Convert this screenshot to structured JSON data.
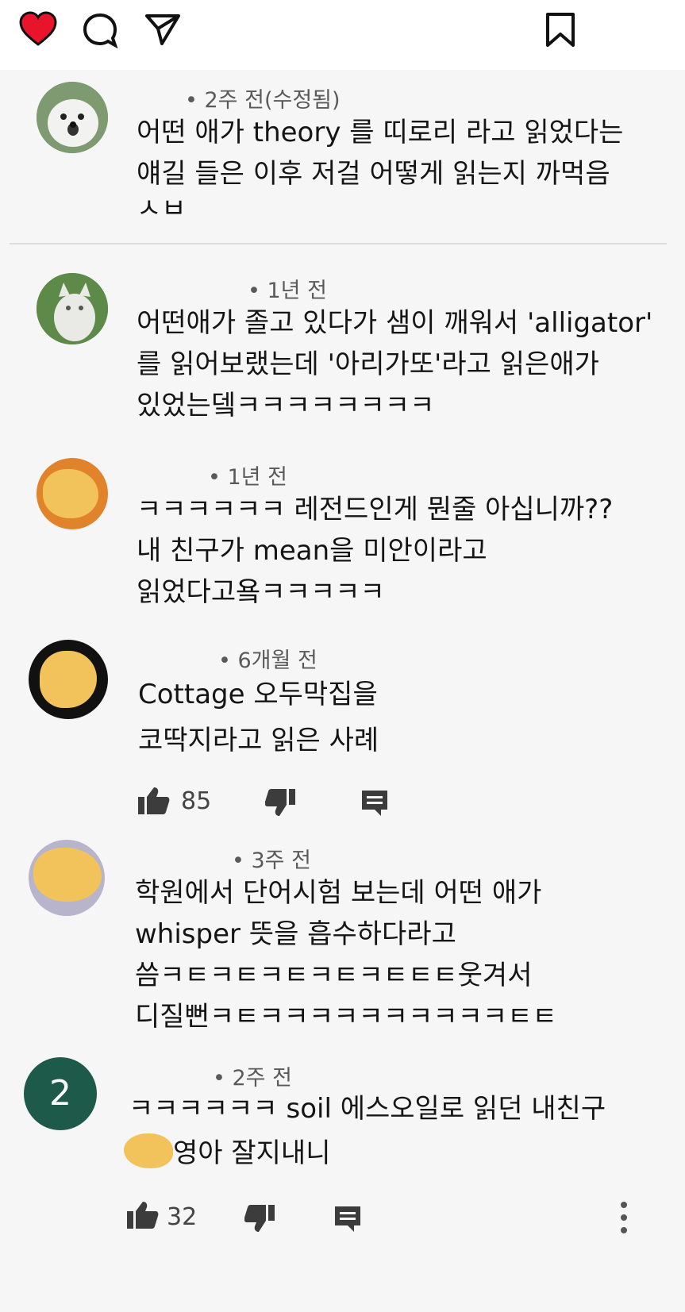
{
  "topbar": {
    "icons": [
      "heart-icon",
      "comment-icon",
      "share-icon",
      "bookmark-icon"
    ],
    "heart_color": "#e8142c"
  },
  "comments": [
    {
      "meta": "• 2주 전(수정됨)",
      "lines": [
        "어떤 애가 theory 를 띠로리 라고 읽었다는",
        "얘길 들은 이후 저걸 어떻게 읽는지 까먹음",
        "ㅅㅂ"
      ]
    },
    {
      "meta": "• 1년 전",
      "lines": [
        "어떤애가 졸고 있다가 샘이 깨워서 'alligator'",
        "를 읽어보랬는데 '아리가또'라고 읽은애가",
        "있었는뎈ㅋㅋㅋㅋㅋㅋㅋㅋ"
      ]
    },
    {
      "meta": "• 1년 전",
      "lines": [
        "ㅋㅋㅋㅋㅋㅋ 레전드인게 뭔줄 아십니까??",
        "내 친구가 mean을 미안이라고",
        "읽었다고욬ㅋㅋㅋㅋㅋ"
      ]
    },
    {
      "meta": "• 6개월 전",
      "lines": [
        "Cottage 오두막집을",
        "코딱지라고 읽은 사례"
      ],
      "likes": "85"
    },
    {
      "meta": "• 3주 전",
      "lines": [
        "학원에서 단어시험 보는데 어떤 애가",
        "whisper 뜻을 흡수하다라고",
        "씀ㅋㅌㅋㅌㅋㅌㅋㅌㅋㅌㅌㅌ웃겨서",
        "디질뻔ㅋㅌㅋㅋㅋㅋㅋㅋㅋㅋㅋㅋㅌㅌ"
      ]
    },
    {
      "meta": "• 2주 전",
      "avatar_letter": "2",
      "lines": [
        "ㅋㅋㅋㅋㅋㅋ soil 에스오일로 읽던 내친구",
        "영아 잘지내니"
      ],
      "likes": "32"
    }
  ],
  "colors": {
    "avatar_orange": "#e0832a",
    "avatar_green": "#1e5a4a",
    "blur_blob": "#f2c35a"
  }
}
